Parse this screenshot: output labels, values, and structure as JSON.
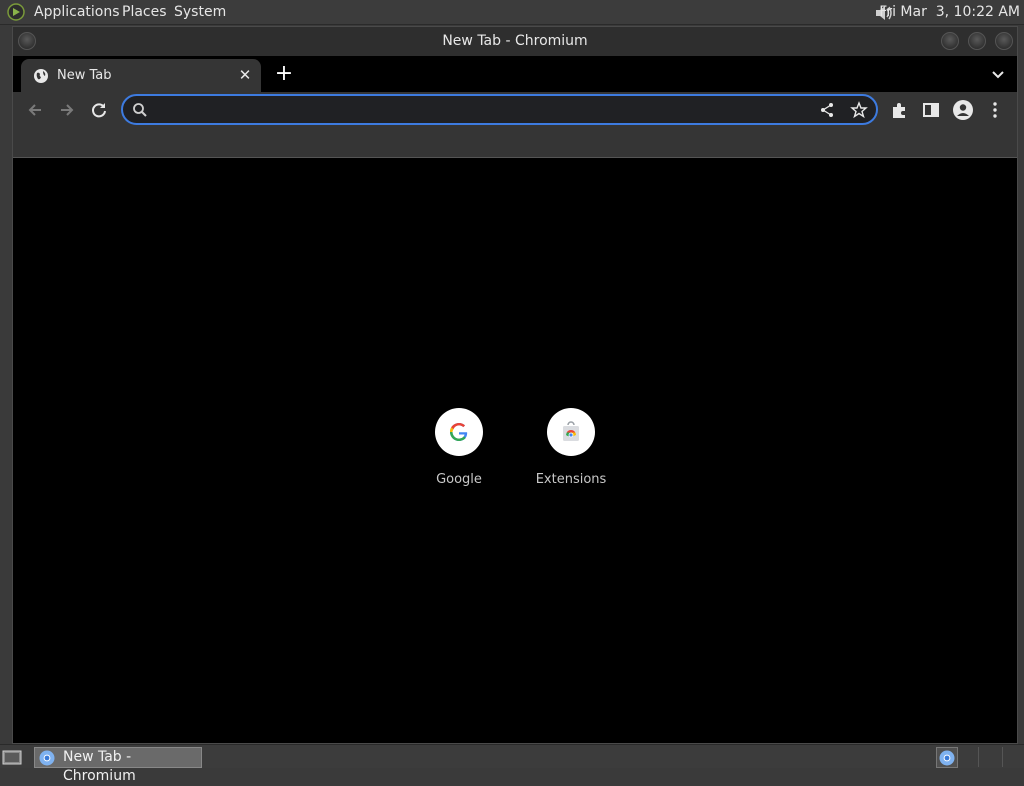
{
  "top_panel": {
    "menus": [
      "Applications",
      "Places",
      "System"
    ],
    "clock": "Fri Mar  3, 10:22 AM"
  },
  "window": {
    "title": "New Tab - Chromium"
  },
  "tabs": [
    {
      "label": "New Tab"
    }
  ],
  "omnibox": {
    "value": "",
    "placeholder": ""
  },
  "shortcuts": [
    {
      "label": "Google"
    },
    {
      "label": "Extensions"
    }
  ],
  "taskbar": {
    "task_label": "New Tab - Chromium"
  },
  "colors": {
    "accent": "#3d7be0",
    "panel": "#3c3c3c",
    "toolbar": "#353535",
    "content_bg": "#000000"
  }
}
